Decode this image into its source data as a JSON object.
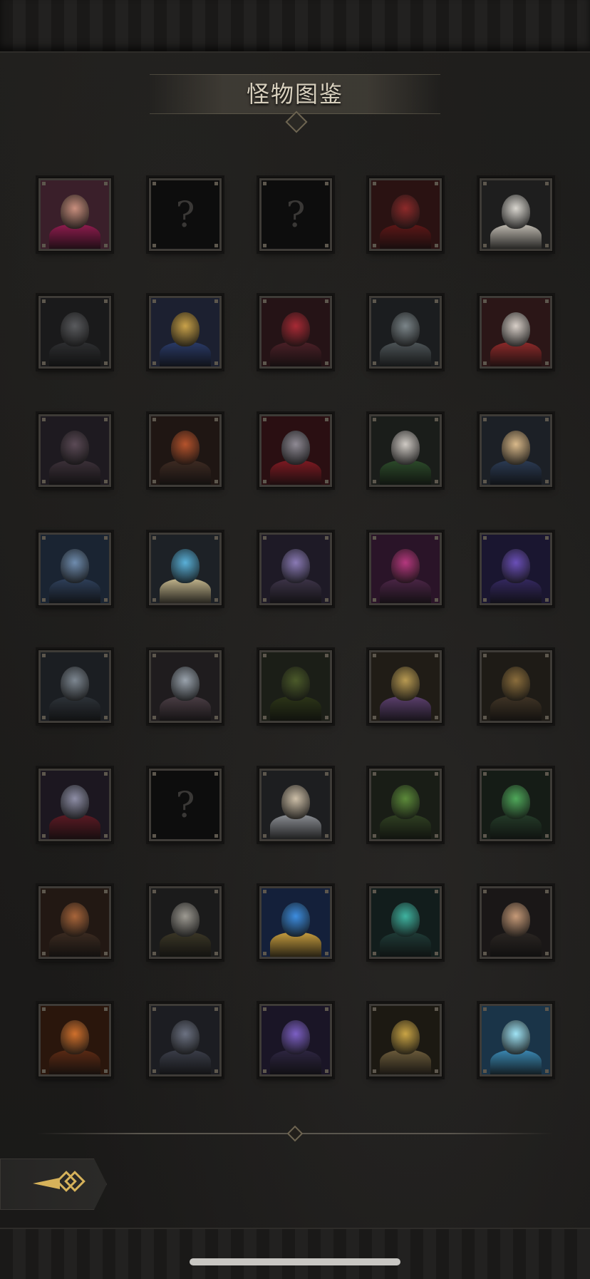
{
  "header": {
    "title": "怪物图鉴"
  },
  "colors": {
    "frame": "#3e3b37",
    "gold": "#d6b25a",
    "title": "#d7cfbd"
  },
  "monsters": [
    {
      "status": "unlocked",
      "icon": "red-haired-woman-portrait-icon",
      "bg": "#3a1f2a",
      "head": "#c98f7e",
      "body": "#8e1c4e"
    },
    {
      "status": "locked",
      "icon": "question-mark-icon",
      "label": "?"
    },
    {
      "status": "locked",
      "icon": "question-mark-icon",
      "label": "?"
    },
    {
      "status": "unlocked",
      "icon": "red-dragon-beast-icon",
      "bg": "#2a1212",
      "head": "#8d2a2a",
      "body": "#5c1717"
    },
    {
      "status": "unlocked",
      "icon": "white-hooded-figure-icon",
      "bg": "#1e1e1e",
      "head": "#d9d6cf",
      "body": "#bdb8ae"
    },
    {
      "status": "unlocked",
      "icon": "black-armored-knight-icon",
      "bg": "#1a1a1b",
      "head": "#5a5b5e",
      "body": "#2d2e30"
    },
    {
      "status": "unlocked",
      "icon": "gold-crowned-lich-icon",
      "bg": "#1c2030",
      "head": "#c9a24a",
      "body": "#2a3a66"
    },
    {
      "status": "unlocked",
      "icon": "crimson-dragon-head-icon",
      "bg": "#251316",
      "head": "#a82a35",
      "body": "#4a2027"
    },
    {
      "status": "unlocked",
      "icon": "grey-hooded-cultist-icon",
      "bg": "#1b1d1f",
      "head": "#7b8589",
      "body": "#4d5457"
    },
    {
      "status": "unlocked",
      "icon": "jester-clown-icon",
      "bg": "#2b1617",
      "head": "#d8cfc8",
      "body": "#8c2a2a"
    },
    {
      "status": "unlocked",
      "icon": "spiked-egg-sac-icon",
      "bg": "#1e1a20",
      "head": "#5b4a56",
      "body": "#3b3038"
    },
    {
      "status": "unlocked",
      "icon": "hooded-sorceress-icon",
      "bg": "#1f1613",
      "head": "#b5532c",
      "body": "#3d2a22"
    },
    {
      "status": "unlocked",
      "icon": "red-hooded-assassin-icon",
      "bg": "#2a0f12",
      "head": "#8f8a94",
      "body": "#7c1a22"
    },
    {
      "status": "unlocked",
      "icon": "silver-haired-youth-icon",
      "bg": "#1a1d1a",
      "head": "#cfcac4",
      "body": "#2c4a2a"
    },
    {
      "status": "unlocked",
      "icon": "blonde-hooded-maiden-icon",
      "bg": "#1c2026",
      "head": "#d9b98a",
      "body": "#2b3a52"
    },
    {
      "status": "unlocked",
      "icon": "cyclops-troll-icon",
      "bg": "#1a2432",
      "head": "#6f8cae",
      "body": "#2e3f59"
    },
    {
      "status": "unlocked",
      "icon": "blue-orb-shield-golem-icon",
      "bg": "#1d2126",
      "head": "#5ab0d8",
      "body": "#bfb28a"
    },
    {
      "status": "unlocked",
      "icon": "horned-purple-demoness-icon",
      "bg": "#1e1a26",
      "head": "#8a7ab5",
      "body": "#3c3347"
    },
    {
      "status": "unlocked",
      "icon": "magenta-spiked-demon-icon",
      "bg": "#2a1428",
      "head": "#b4387e",
      "body": "#4a2545"
    },
    {
      "status": "unlocked",
      "icon": "violet-lizard-beast-icon",
      "bg": "#1a1630",
      "head": "#6a4fb8",
      "body": "#34285e"
    },
    {
      "status": "unlocked",
      "icon": "maned-beast-lord-icon",
      "bg": "#1b1e22",
      "head": "#7d8791",
      "body": "#2d3238"
    },
    {
      "status": "unlocked",
      "icon": "pink-crested-orc-icon",
      "bg": "#1f1c1e",
      "head": "#9aa3ad",
      "body": "#4a3d44"
    },
    {
      "status": "unlocked",
      "icon": "green-thorn-treant-icon",
      "bg": "#1b1e17",
      "head": "#4b5a2a",
      "body": "#2c3518"
    },
    {
      "status": "unlocked",
      "icon": "golden-clockwork-goblin-icon",
      "bg": "#201c16",
      "head": "#b89a52",
      "body": "#5b3f6c"
    },
    {
      "status": "unlocked",
      "icon": "bronze-war-machine-icon",
      "bg": "#1e1b16",
      "head": "#8a6d3c",
      "body": "#3f3325"
    },
    {
      "status": "unlocked",
      "icon": "horned-vampire-lord-icon",
      "bg": "#1c1720",
      "head": "#8e8ea6",
      "body": "#5a1a24"
    },
    {
      "status": "locked",
      "icon": "question-mark-icon",
      "label": "?"
    },
    {
      "status": "unlocked",
      "icon": "silver-crowned-elf-icon",
      "bg": "#1d1e20",
      "head": "#cdbfa8",
      "body": "#8a8d92"
    },
    {
      "status": "unlocked",
      "icon": "green-orc-warlord-icon",
      "bg": "#191d16",
      "head": "#5c8a3a",
      "body": "#2f3f22"
    },
    {
      "status": "unlocked",
      "icon": "emerald-blade-wraith-icon",
      "bg": "#151c16",
      "head": "#4fa85a",
      "body": "#243a28"
    },
    {
      "status": "unlocked",
      "icon": "lion-man-warrior-icon",
      "bg": "#221813",
      "head": "#a8653a",
      "body": "#3a2a20"
    },
    {
      "status": "unlocked",
      "icon": "golden-scythe-reaper-icon",
      "bg": "#1b1b1b",
      "head": "#9d9a92",
      "body": "#3a3626"
    },
    {
      "status": "unlocked",
      "icon": "azure-crystal-sigil-icon",
      "bg": "#14203a",
      "head": "#3d8de0",
      "body": "#c49b3e"
    },
    {
      "status": "unlocked",
      "icon": "teal-hooded-lich-icon",
      "bg": "#121d1c",
      "head": "#3fb3a0",
      "body": "#1f3a36"
    },
    {
      "status": "unlocked",
      "icon": "dark-haired-rogue-icon",
      "bg": "#1a1717",
      "head": "#c69a78",
      "body": "#2a2522"
    },
    {
      "status": "unlocked",
      "icon": "fire-horned-demon-icon",
      "bg": "#2a160c",
      "head": "#d0702c",
      "body": "#5a2a14"
    },
    {
      "status": "unlocked",
      "icon": "grey-dire-wolf-icon",
      "bg": "#1c1d22",
      "head": "#6c7282",
      "body": "#3a3d48"
    },
    {
      "status": "unlocked",
      "icon": "void-dragon-icon",
      "bg": "#1a1526",
      "head": "#7c5fc4",
      "body": "#2d2540"
    },
    {
      "status": "unlocked",
      "icon": "golden-masked-monk-icon",
      "bg": "#1c1912",
      "head": "#c9a445",
      "body": "#6a5a3a"
    },
    {
      "status": "unlocked",
      "icon": "ice-crowned-king-icon",
      "bg": "#1a3448",
      "head": "#9fe3f5",
      "body": "#3a86b0"
    }
  ]
}
